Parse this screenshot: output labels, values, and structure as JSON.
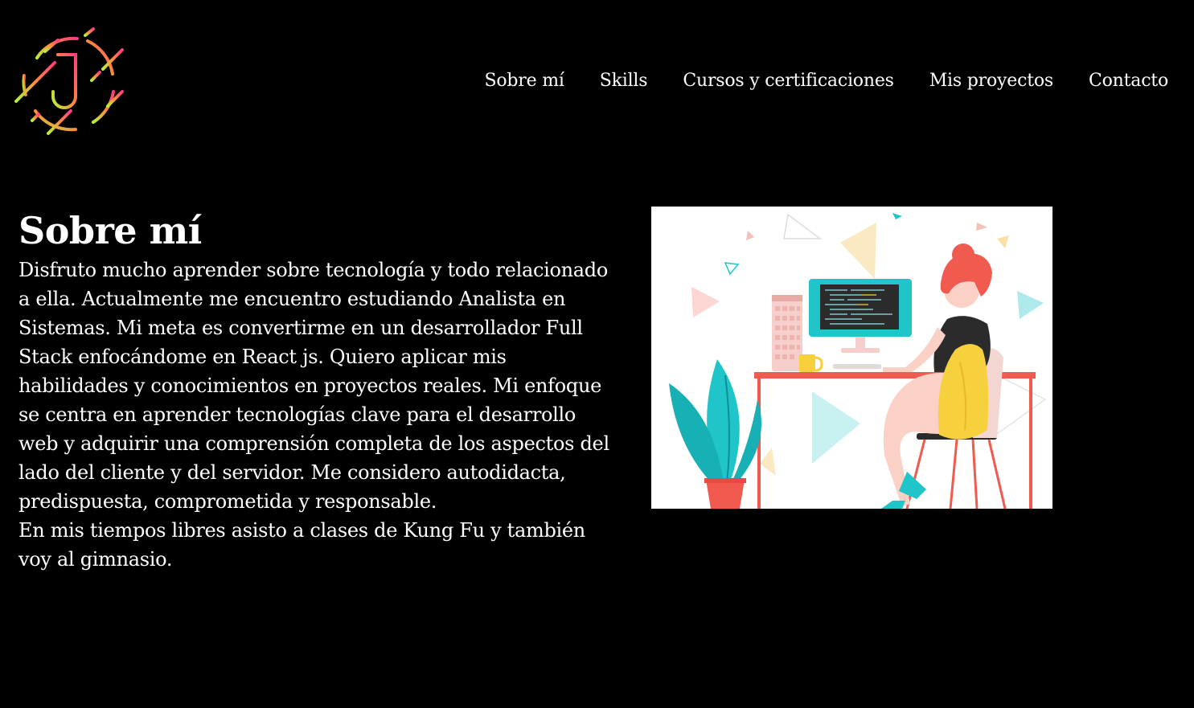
{
  "logo": {
    "letter": "J",
    "icon": "j-logo-icon"
  },
  "nav": {
    "items": [
      {
        "label": "Sobre mí"
      },
      {
        "label": "Skills"
      },
      {
        "label": "Cursos y certificaciones"
      },
      {
        "label": "Mis proyectos"
      },
      {
        "label": "Contacto"
      }
    ]
  },
  "about": {
    "title": "Sobre mí",
    "paragraph_1": "Disfruto mucho aprender sobre tecnología y todo relacionado a ella. Actualmente me encuentro estudiando Analista en Sistemas. Mi meta es convertirme en un desarrollador Full Stack enfocándome en React js. Quiero aplicar mis habilidades y conocimientos en proyectos reales. Mi enfoque se centra en aprender tecnologías clave para el desarrollo web y adquirir una comprensión completa de los aspectos del lado del cliente y del servidor. Me considero autodidacta, predispuesta, comprometida y responsable.",
    "paragraph_2": "En mis tiempos libres asisto a clases de Kung Fu y también voy al gimnasio."
  },
  "illustration": {
    "icon": "woman-at-desk-illustration"
  },
  "colors": {
    "background": "#000000",
    "text": "#ffffff",
    "accent_teal": "#1fc5c9",
    "accent_coral": "#f05a4f",
    "accent_yellow": "#f7d13d"
  }
}
